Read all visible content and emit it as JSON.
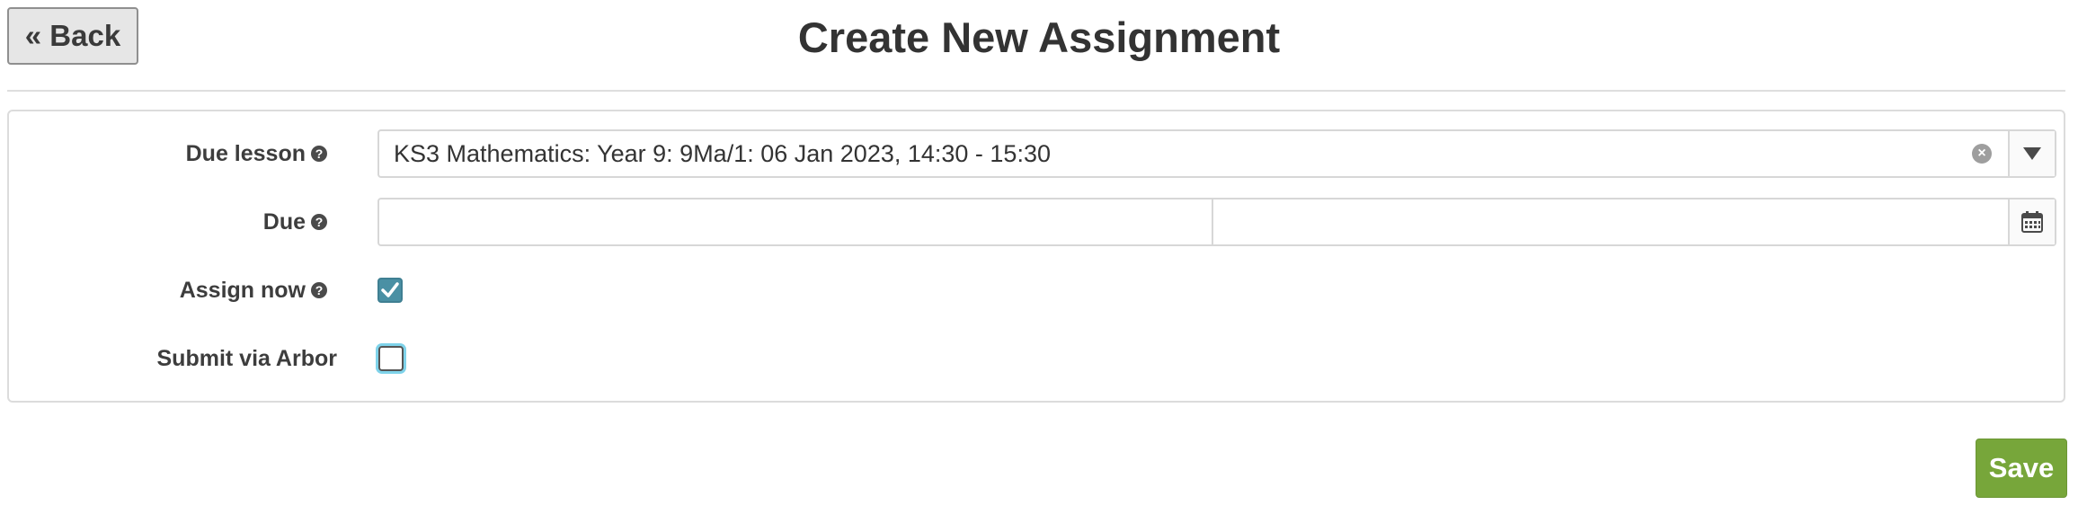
{
  "header": {
    "back_label": "« Back",
    "title": "Create New Assignment"
  },
  "form": {
    "due_lesson": {
      "label": "Due lesson",
      "value": "KS3 Mathematics: Year 9: 9Ma/1: 06 Jan 2023, 14:30 - 15:30"
    },
    "due": {
      "label": "Due",
      "date_value": "",
      "time_value": ""
    },
    "assign_now": {
      "label": "Assign now",
      "checked": true
    },
    "submit_via_arbor": {
      "label": "Submit via Arbor",
      "checked": false
    }
  },
  "footer": {
    "save_label": "Save"
  },
  "colors": {
    "save_button": "#77a63a",
    "checkbox_checked": "#4a90a4",
    "focus_ring": "#7fd3ea"
  },
  "icons": {
    "help": "question-circle-icon",
    "clear": "times-circle-icon",
    "dropdown": "triangle-down-icon",
    "calendar": "calendar-icon",
    "check": "checkmark-icon"
  }
}
